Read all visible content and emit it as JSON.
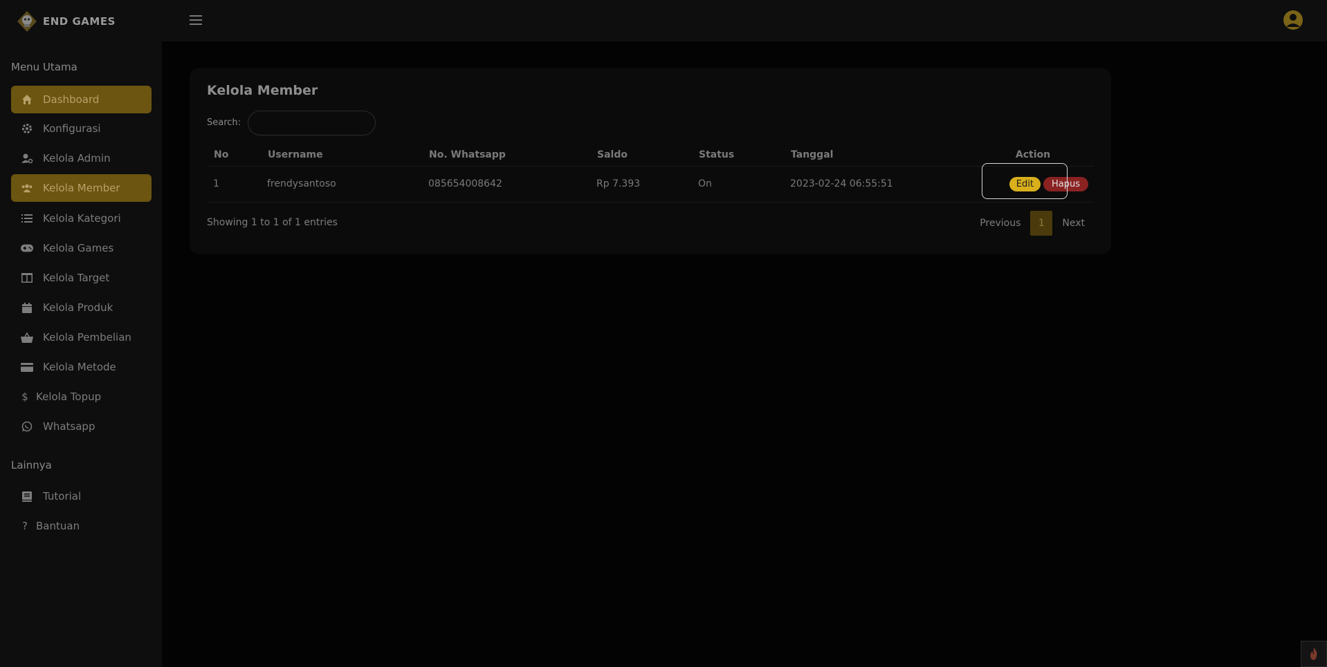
{
  "brand": {
    "name": "END GAMES"
  },
  "sidebar": {
    "heading_main": "Menu Utama",
    "heading_other": "Lainnya",
    "items": [
      {
        "label": "Dashboard",
        "icon": "home-icon"
      },
      {
        "label": "Konfigurasi",
        "icon": "gear-icon"
      },
      {
        "label": "Kelola Admin",
        "icon": "user-cog-icon"
      },
      {
        "label": "Kelola Member",
        "icon": "users-icon"
      },
      {
        "label": "Kelola Kategori",
        "icon": "list-icon"
      },
      {
        "label": "Kelola Games",
        "icon": "gamepad-icon"
      },
      {
        "label": "Kelola Target",
        "icon": "columns-icon"
      },
      {
        "label": "Kelola Produk",
        "icon": "calendar-icon"
      },
      {
        "label": "Kelola Pembelian",
        "icon": "basket-icon"
      },
      {
        "label": "Kelola Metode",
        "icon": "credit-card-icon"
      },
      {
        "label": "Kelola Topup",
        "icon": "dollar-icon"
      },
      {
        "label": "Whatsapp",
        "icon": "whatsapp-icon"
      }
    ],
    "other_items": [
      {
        "label": "Tutorial",
        "icon": "book-icon"
      },
      {
        "label": "Bantuan",
        "icon": "question-icon"
      }
    ]
  },
  "card": {
    "title": "Kelola Member",
    "search_label": "Search:",
    "search_value": ""
  },
  "table": {
    "headers": [
      "No",
      "Username",
      "No. Whatsapp",
      "Saldo",
      "Status",
      "Tanggal",
      "Action"
    ],
    "rows": [
      {
        "no": "1",
        "username": "frendysantoso",
        "whatsapp": "085654008642",
        "saldo": "Rp 7.393",
        "status": "On",
        "tanggal": "2023-02-24 06:55:51",
        "edit_label": "Edit",
        "delete_label": "Hapus"
      }
    ]
  },
  "footer": {
    "info": "Showing 1 to 1 of 1 entries",
    "previous": "Previous",
    "page": "1",
    "next": "Next"
  },
  "colors": {
    "accent": "#6b5510",
    "edit": "#d9b01c",
    "delete": "#8a2222"
  }
}
